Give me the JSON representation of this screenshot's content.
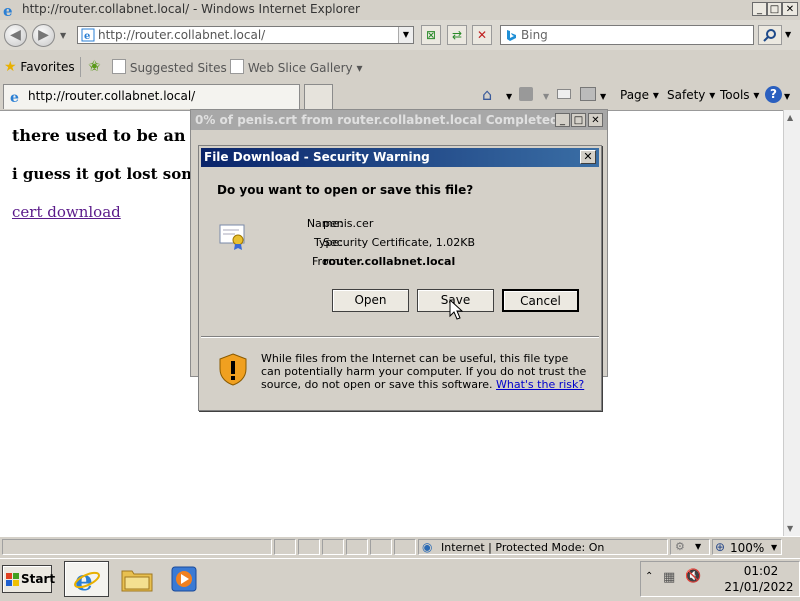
{
  "window": {
    "title": "http://router.collabnet.local/ - Windows Internet Explorer"
  },
  "navbar": {
    "address": "http://router.collabnet.local/",
    "search_placeholder": "Bing"
  },
  "favorites_bar": {
    "favorites_label": "Favorites",
    "items": [
      {
        "label": "Suggested Sites ▾"
      },
      {
        "label": "Web Slice Gallery ▾"
      }
    ]
  },
  "tab": {
    "label": "http://router.collabnet.local/"
  },
  "command_bar": {
    "page": "Page ▾",
    "safety": "Safety ▾",
    "tools": "Tools ▾"
  },
  "page": {
    "heading1": "there used to be an ind",
    "heading2": "i guess it got lost somewhe",
    "link": "cert download"
  },
  "bg_window": {
    "title": "0% of penis.crt from router.collabnet.local Completed"
  },
  "dialog": {
    "title": "File Download - Security Warning",
    "question": "Do you want to open or save this file?",
    "name_label": "Name:",
    "name_value": "penis.cer",
    "type_label": "Type:",
    "type_value": "Security Certificate, 1.02KB",
    "from_label": "From:",
    "from_value": "router.collabnet.local",
    "buttons": {
      "open": "Open",
      "save": "Save",
      "cancel": "Cancel"
    },
    "warning": "While files from the Internet can be useful, this file type can potentially harm your computer. If you do not trust the source, do not open or save this software.",
    "risk_link": "What's the risk?"
  },
  "statusbar": {
    "zone": "Internet | Protected Mode: On",
    "zoom": "100%"
  },
  "taskbar": {
    "start": "Start",
    "time": "01:02",
    "date": "21/01/2022"
  }
}
